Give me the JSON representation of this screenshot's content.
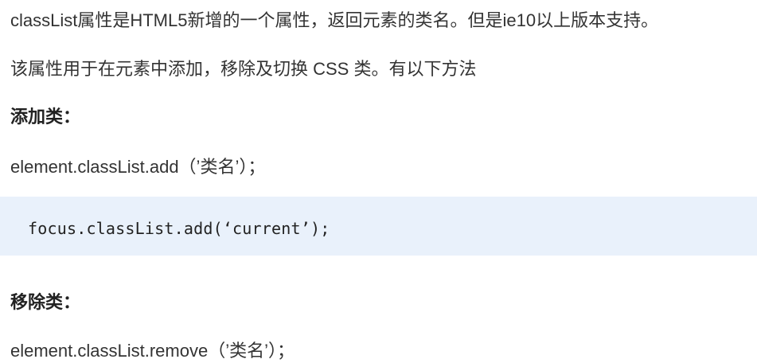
{
  "document": {
    "intro_line_1": "classList属性是HTML5新增的一个属性，返回元素的类名。但是ie10以上版本支持。",
    "intro_line_2": "该属性用于在元素中添加，移除及切换 CSS 类。有以下方法",
    "add_heading": "添加类：",
    "add_syntax": "element.classList.add（’类名’）；",
    "add_example_code": "focus.classList.add(‘current’);",
    "remove_heading": "移除类：",
    "remove_syntax": "element.classList.remove（’类名’）；"
  }
}
